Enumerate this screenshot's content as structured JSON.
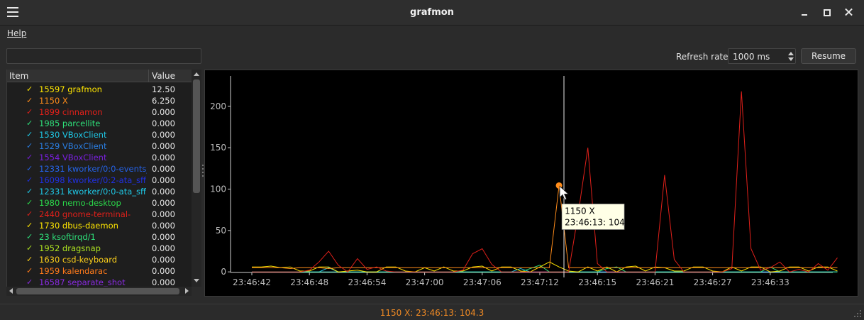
{
  "window": {
    "title": "grafmon",
    "menu_icon": "hamburger-menu-icon",
    "buttons": [
      "minimize-icon",
      "maximize-icon",
      "close-icon"
    ]
  },
  "menubar": {
    "help": "Help"
  },
  "filter": {
    "value": "",
    "placeholder": ""
  },
  "refresh": {
    "label": "Refresh rate:",
    "value": "1000 ms"
  },
  "resume": {
    "label": "Resume"
  },
  "list": {
    "headers": {
      "item": "Item",
      "value": "Value"
    },
    "rows": [
      {
        "label": "15597 grafmon",
        "value": "12.50",
        "color": "#ffe600"
      },
      {
        "label": "1150 X",
        "value": "6.250",
        "color": "#ff8c1a"
      },
      {
        "label": "1899 cinnamon",
        "value": "0.000",
        "color": "#e0201a"
      },
      {
        "label": "1985 parcellite",
        "value": "0.000",
        "color": "#2ee07a"
      },
      {
        "label": "1530 VBoxClient",
        "value": "0.000",
        "color": "#1ec8e6"
      },
      {
        "label": "1529 VBoxClient",
        "value": "0.000",
        "color": "#2a7de0"
      },
      {
        "label": "1554 VBoxClient",
        "value": "0.000",
        "color": "#7a1ee0"
      },
      {
        "label": "12331 kworker/0:0-events_...",
        "value": "0.000",
        "color": "#2563e8"
      },
      {
        "label": "16098 kworker/0:2-ata_sff",
        "value": "0.000",
        "color": "#2030e0"
      },
      {
        "label": "12331 kworker/0:0-ata_sff",
        "value": "0.000",
        "color": "#1ec8e6"
      },
      {
        "label": "1980 nemo-desktop",
        "value": "0.000",
        "color": "#2ad94a"
      },
      {
        "label": "2440 gnome-terminal-",
        "value": "0.000",
        "color": "#e0201a"
      },
      {
        "label": "1730 dbus-daemon",
        "value": "0.000",
        "color": "#ffe600"
      },
      {
        "label": "23 ksoftirqd/1",
        "value": "0.000",
        "color": "#2ee07a"
      },
      {
        "label": "1952 dragsnap",
        "value": "0.000",
        "color": "#b0e620"
      },
      {
        "label": "1630 csd-keyboard",
        "value": "0.000",
        "color": "#ffd21a"
      },
      {
        "label": "1959 kalendarac",
        "value": "0.000",
        "color": "#ff7a1a"
      },
      {
        "label": "16587 separate_shot",
        "value": "0.000",
        "color": "#8a2be2"
      }
    ],
    "check_glyph": "✓"
  },
  "chart_data": {
    "type": "line",
    "x": [
      "23:46:42",
      "23:46:43",
      "23:46:44",
      "23:46:45",
      "23:46:46",
      "23:46:47",
      "23:46:48",
      "23:46:49",
      "23:46:50",
      "23:46:51",
      "23:46:52",
      "23:46:53",
      "23:46:54",
      "23:46:55",
      "23:46:56",
      "23:46:57",
      "23:46:58",
      "23:46:59",
      "23:47:00",
      "23:47:01",
      "23:47:02",
      "23:47:03",
      "23:47:04",
      "23:47:05",
      "23:47:06",
      "23:47:07",
      "23:47:08",
      "23:47:09",
      "23:47:10",
      "23:47:11",
      "23:47:12",
      "23:47:13",
      "23:47:14",
      "23:47:15",
      "23:46:13",
      "23:46:14",
      "23:46:15",
      "23:46:16",
      "23:46:17",
      "23:46:18",
      "23:46:19",
      "23:46:20",
      "23:46:21",
      "23:46:22",
      "23:46:23",
      "23:46:24",
      "23:46:25",
      "23:46:26",
      "23:46:27",
      "23:46:28",
      "23:46:29",
      "23:46:30",
      "23:46:31",
      "23:46:32",
      "23:46:33",
      "23:46:34",
      "23:46:35",
      "23:46:36",
      "23:46:37",
      "23:46:38",
      "23:46:39"
    ],
    "xticks": [
      "23:46:42",
      "23:46:48",
      "23:46:54",
      "23:47:00",
      "23:47:06",
      "23:47:12",
      "23:46:15",
      "23:46:21",
      "23:46:27",
      "23:46:33"
    ],
    "ylim": [
      -5,
      235
    ],
    "yticks": [
      0,
      50,
      100,
      150,
      200
    ],
    "grid": false,
    "legend": "none",
    "background": "#000000",
    "cursor_x_index": 32,
    "series": [
      {
        "name": "2440 gnome-terminal-",
        "color": "#e0201a",
        "values": [
          0,
          0,
          0,
          0,
          0,
          0,
          2,
          12,
          25,
          8,
          0,
          16,
          3,
          6,
          1,
          0,
          0,
          0,
          0,
          0,
          0,
          0,
          2,
          22,
          28,
          9,
          0,
          0,
          0,
          0,
          0,
          0,
          0,
          0,
          70,
          150,
          10,
          0,
          0,
          0,
          0,
          0,
          0,
          117,
          15,
          0,
          0,
          0,
          0,
          0,
          4,
          218,
          28,
          2,
          5,
          12,
          0,
          3,
          0,
          10,
          2,
          17
        ]
      },
      {
        "name": "1150 X",
        "color": "#ff8c1a",
        "values": [
          5,
          5,
          5,
          5,
          4,
          5,
          5,
          5,
          4,
          5,
          5,
          5,
          5,
          5,
          5,
          5,
          5,
          5,
          5,
          5,
          5,
          5,
          5,
          5,
          5,
          5,
          5,
          5,
          5,
          5,
          5,
          5,
          104.3,
          5,
          5,
          5,
          5,
          5,
          5,
          5,
          5,
          5,
          5,
          5,
          5,
          5,
          5,
          5,
          5,
          5,
          5,
          5,
          5,
          5,
          5,
          5,
          5,
          5,
          5,
          5,
          5,
          5
        ]
      },
      {
        "name": "15597 grafmon",
        "color": "#ffe600",
        "values": [
          6,
          6,
          7,
          5,
          6,
          1,
          1,
          6,
          6,
          0,
          1,
          2,
          0,
          0,
          6,
          6,
          1,
          0,
          5,
          1,
          6,
          1,
          1,
          6,
          7,
          1,
          6,
          6,
          1,
          0,
          6,
          12,
          6,
          1,
          0,
          6,
          1,
          6,
          0,
          6,
          7,
          1,
          6,
          5,
          1,
          1,
          6,
          6,
          1,
          0,
          6,
          1,
          6,
          6,
          0,
          1,
          6,
          6,
          1,
          6,
          6,
          1
        ]
      },
      {
        "name": "1985 parcellite",
        "color": "#2ee07a",
        "values": [
          0,
          0,
          0,
          0,
          0,
          0,
          0,
          0,
          0,
          0,
          0,
          0,
          0,
          0,
          0,
          0,
          0,
          0,
          0,
          0,
          0,
          0,
          0,
          0,
          0,
          0,
          0,
          0,
          0,
          4,
          8,
          0,
          0,
          0,
          0,
          0,
          0,
          4,
          6,
          0,
          0,
          0,
          0,
          0,
          0,
          0,
          0,
          0,
          0,
          0,
          0,
          0,
          0,
          0,
          6,
          0,
          0,
          0,
          0,
          0,
          0,
          0
        ]
      },
      {
        "name": "1530 VBoxClient",
        "color": "#1ec8e6",
        "values": [
          0,
          0,
          0,
          0,
          0,
          0,
          0,
          0,
          5,
          0,
          0,
          0,
          0,
          0,
          0,
          0,
          0,
          0,
          0,
          0,
          0,
          0,
          0,
          0,
          0,
          0,
          0,
          0,
          4,
          0,
          0,
          0,
          0,
          0,
          0,
          0,
          0,
          0,
          0,
          0,
          0,
          0,
          0,
          0,
          0,
          0,
          0,
          0,
          0,
          0,
          0,
          0,
          0,
          0,
          0,
          0,
          0,
          0,
          0,
          0,
          0,
          0
        ]
      },
      {
        "name": "1554 VBoxClient",
        "color": "#7a1ee0",
        "values": [
          0,
          0,
          0,
          0,
          0,
          0,
          0,
          0,
          0,
          0,
          0,
          0,
          0,
          0,
          0,
          0,
          0,
          0,
          0,
          0,
          0,
          0,
          0,
          0,
          0,
          0,
          0,
          0,
          0,
          0,
          0,
          0,
          0,
          0,
          0,
          0,
          0,
          0,
          0,
          0,
          0,
          0,
          0,
          0,
          0,
          0,
          0,
          0,
          0,
          0,
          0,
          0,
          0,
          0,
          0,
          0,
          0,
          0,
          0,
          0,
          0,
          0
        ]
      },
      {
        "name": "1529 VBoxClient",
        "color": "#2a7de0",
        "values": [
          0,
          0,
          0,
          0,
          0,
          0,
          0,
          0,
          0,
          0,
          0,
          0,
          0,
          0,
          0,
          0,
          0,
          0,
          0,
          0,
          0,
          0,
          0,
          0,
          0,
          0,
          0,
          0,
          0,
          0,
          0,
          0,
          0,
          0,
          0,
          0,
          0,
          0,
          0,
          0,
          0,
          0,
          0,
          0,
          0,
          0,
          0,
          0,
          0,
          0,
          0,
          0,
          0,
          0,
          0,
          0,
          0,
          0,
          0,
          0,
          0,
          0
        ]
      }
    ],
    "highlight_series": "1150 X",
    "tooltip": {
      "title": "1150 X",
      "text": "23:46:13: 104.3"
    }
  },
  "status": {
    "text": "1150 X: 23:46:13: 104.3"
  }
}
